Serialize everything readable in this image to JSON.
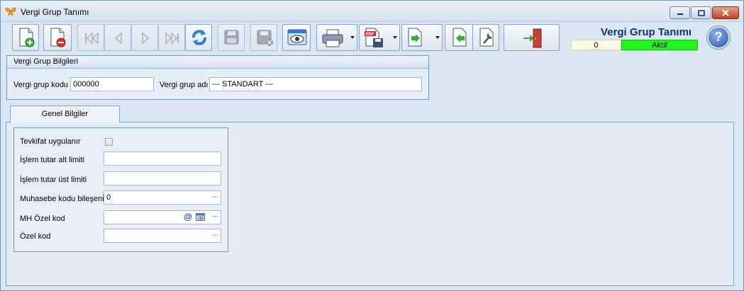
{
  "window": {
    "title": "Vergi Grup Tanımı"
  },
  "toolbar": {
    "buttons": [
      {
        "name": "new-record-button",
        "icon": "new-document-icon",
        "enabled": true
      },
      {
        "name": "delete-record-button",
        "icon": "delete-document-icon",
        "enabled": true
      },
      {
        "name": "first-record-button",
        "icon": "first-icon",
        "enabled": false
      },
      {
        "name": "previous-record-button",
        "icon": "previous-icon",
        "enabled": false
      },
      {
        "name": "next-record-button",
        "icon": "next-icon",
        "enabled": false
      },
      {
        "name": "last-record-button",
        "icon": "last-icon",
        "enabled": false
      },
      {
        "name": "refresh-button",
        "icon": "refresh-icon",
        "enabled": true
      },
      {
        "name": "save-button",
        "icon": "save-icon",
        "enabled": false
      },
      {
        "name": "cancel-save-button",
        "icon": "cancel-save-icon",
        "enabled": false
      },
      {
        "name": "preview-button",
        "icon": "preview-icon",
        "enabled": true
      },
      {
        "name": "print-button",
        "icon": "printer-icon",
        "enabled": true
      },
      {
        "name": "pdf-export-button",
        "icon": "pdf-save-icon",
        "enabled": true
      },
      {
        "name": "export-button",
        "icon": "export-icon",
        "enabled": true
      },
      {
        "name": "import-button",
        "icon": "import-icon",
        "enabled": true
      },
      {
        "name": "settings-button",
        "icon": "wrench-document-icon",
        "enabled": true
      },
      {
        "name": "exit-button",
        "icon": "exit-door-icon",
        "enabled": true
      }
    ]
  },
  "header": {
    "form_title": "Vergi Grup Tanımı",
    "counter": "0",
    "status": "Aktif",
    "status_color": "#1ff51f",
    "help_label": "?"
  },
  "group_info": {
    "title": "Vergi Grup Bilgileri",
    "code_label": "Vergi grup kodu",
    "code_value": "000000",
    "name_label": "Vergi grup adı",
    "name_value": "--- STANDART ---"
  },
  "tabs": [
    {
      "label": "Genel Bilgiler"
    }
  ],
  "general": {
    "withholding_label": "Tevkifat uygulanır",
    "withholding_checked": false,
    "min_amount_label": "İşlem tutar alt limiti",
    "min_amount_value": "",
    "max_amount_label": "İşlem tutar üst limiti",
    "max_amount_value": "",
    "accounting_label": "Muhasebe kodu bileşeni",
    "accounting_value": "0",
    "mh_special_label": "MH Özel kod",
    "mh_special_value": "",
    "special_label": "Özel kod",
    "special_value": "",
    "ellipsis": "···",
    "at_symbol": "@"
  }
}
